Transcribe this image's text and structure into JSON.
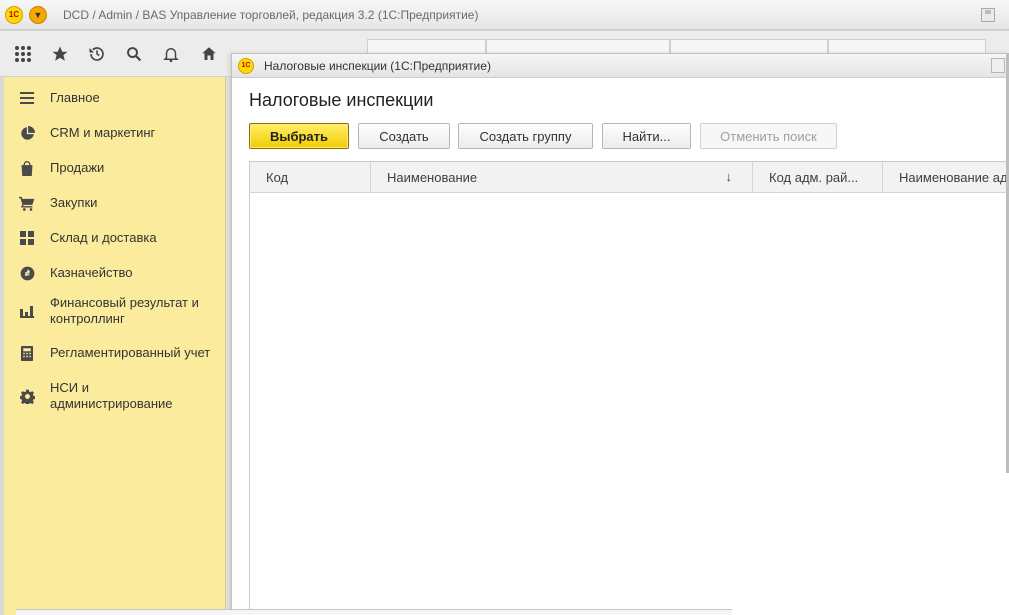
{
  "app": {
    "logo_text": "1С",
    "title": "DCD / Admin / BAS Управление торговлей, редакция 3.2  (1С:Предприятие)"
  },
  "toolbar": {
    "icons": [
      "apps-grid-icon",
      "favorites-star-icon",
      "history-icon",
      "search-icon",
      "notifications-bell-icon",
      "home-icon"
    ]
  },
  "sidebar": {
    "items": [
      {
        "label": "Главное",
        "icon": "menu-lines-icon"
      },
      {
        "label": "CRM и маркетинг",
        "icon": "pie-chart-icon"
      },
      {
        "label": "Продажи",
        "icon": "shopping-bag-icon"
      },
      {
        "label": "Закупки",
        "icon": "cart-icon"
      },
      {
        "label": "Склад и доставка",
        "icon": "warehouse-grid-icon"
      },
      {
        "label": "Казначейство",
        "icon": "currency-coin-icon"
      },
      {
        "label": "Финансовый результат и контроллинг",
        "icon": "bar-chart-icon"
      },
      {
        "label": "Регламентированный учет",
        "icon": "calculator-icon"
      },
      {
        "label": "НСИ и администрирование",
        "icon": "gear-icon"
      }
    ]
  },
  "modal": {
    "window_title": "Налоговые инспекции  (1С:Предприятие)",
    "page_title": "Налоговые инспекции",
    "buttons": {
      "select": "Выбрать",
      "create": "Создать",
      "create_group": "Создать группу",
      "find": "Найти...",
      "cancel_search": "Отменить поиск"
    },
    "table": {
      "columns": [
        "Код",
        "Наименование",
        "Код адм. рай...",
        "Наименование ад"
      ],
      "sort_indicator": "↓",
      "rows": []
    }
  },
  "colors": {
    "sidebar_bg": "#fbec9d",
    "primary_button": "#f2cb00",
    "logo_yellow": "#ffd800",
    "logo_red": "#c00000"
  }
}
